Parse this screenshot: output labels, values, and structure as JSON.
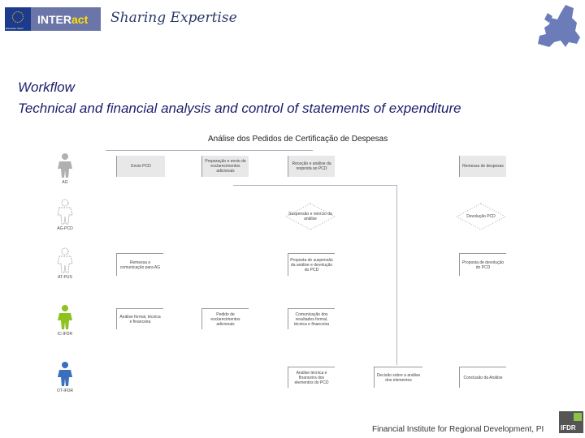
{
  "header": {
    "eu_label": "European Union",
    "brand_prefix": "INTER",
    "brand_suffix": "act",
    "tagline": "Sharing Expertise"
  },
  "slide": {
    "title": "Workflow",
    "subtitle": "Technical and financial analysis and control of statements of expenditure"
  },
  "diagram": {
    "title": "Análise dos Pedidos de Certificação de Despesas",
    "actors": [
      {
        "label": "AG",
        "color": "#b0b0b0"
      },
      {
        "label": "AG-PCD",
        "color": "#ffffff"
      },
      {
        "label": "AT-PUS",
        "color": "#ffffff"
      },
      {
        "label": "IC-IFDR",
        "color": "#8dc21f"
      },
      {
        "label": "OT-IFDR",
        "color": "#3a6fc0"
      }
    ],
    "boxes": [
      {
        "text": "Envio PCD"
      },
      {
        "text": "Preparação e envio de esclarecimentos adicionais"
      },
      {
        "text": "Receção e análise da resposta ao PCD"
      },
      {
        "text": "Remessa de despesas"
      },
      {
        "text": "Remessa e comunicação para AG"
      },
      {
        "text": "Proposta de suspensão da análise e devolução do PCD"
      },
      {
        "text": "Proposta de devolução do PCD"
      },
      {
        "text": "Análise formal, técnica e financeira"
      },
      {
        "text": "Pedido de esclarecimentos adicionais"
      },
      {
        "text": "Comunicação dos resultados formal, técnica e financeira"
      },
      {
        "text": "Análise técnica e financeira dos elementos do PCD"
      },
      {
        "text": "Decisão sobre a análise dos elementos"
      },
      {
        "text": "Conclusão da Análise"
      }
    ],
    "decisions": [
      {
        "text": "Suspensão e reinício da análise"
      },
      {
        "text": "Devolução PCD"
      }
    ]
  },
  "footer": {
    "text": "Financial Institute for Regional Development, PI",
    "logo": "IFDR"
  },
  "colors": {
    "title": "#1a1e6a",
    "brand": "#6c75a8",
    "accent_green": "#8dc21f",
    "accent_blue": "#3a6fc0"
  }
}
